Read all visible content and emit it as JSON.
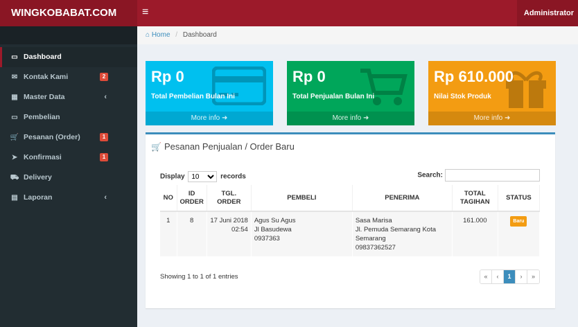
{
  "header": {
    "logo": "WINGKOBABAT.COM",
    "menu_icon": "≡",
    "user": "Administrator"
  },
  "sidebar": {
    "items": [
      {
        "label": "Dashboard",
        "icon": "monitor-icon",
        "glyph": "▭",
        "active": true
      },
      {
        "label": "Kontak Kami",
        "icon": "envelope-icon",
        "glyph": "✉",
        "badge": "2"
      },
      {
        "label": "Master Data",
        "icon": "grid-icon",
        "glyph": "▦",
        "chevron": "‹"
      },
      {
        "label": "Pembelian",
        "icon": "credit-card-icon",
        "glyph": "▭"
      },
      {
        "label": "Pesanan (Order)",
        "icon": "cart-icon",
        "glyph": "🛒",
        "badge": "1"
      },
      {
        "label": "Konfirmasi",
        "icon": "send-icon",
        "glyph": "➤",
        "badge": "1"
      },
      {
        "label": "Delivery",
        "icon": "truck-icon",
        "glyph": "⛟"
      },
      {
        "label": "Laporan",
        "icon": "book-icon",
        "glyph": "▤",
        "chevron": "‹"
      }
    ]
  },
  "breadcrumb": {
    "home": "Home",
    "current": "Dashboard",
    "separator": "/"
  },
  "stats": [
    {
      "value": "Rp 0",
      "label": "Total Pembelian Bulan Ini",
      "more": "More info",
      "color": "#00c0ef",
      "icon": "credit-card-icon"
    },
    {
      "value": "Rp 0",
      "label": "Total Penjualan Bulan Ini",
      "more": "More info",
      "color": "#00a65a",
      "icon": "cart-icon"
    },
    {
      "value": "Rp 610.000",
      "label": "Nilai Stok Produk",
      "more": "More info",
      "color": "#f39c12",
      "icon": "gift-icon"
    }
  ],
  "orders_panel": {
    "title": "Pesanan Penjualan / Order Baru",
    "display_label": "Display",
    "display_value": "10",
    "records_label": "records",
    "search_label": "Search:",
    "columns": [
      "NO",
      "ID ORDER",
      "TGL. ORDER",
      "PEMBELI",
      "PENERIMA",
      "TOTAL TAGIHAN",
      "STATUS"
    ],
    "rows": [
      {
        "no": "1",
        "id": "8",
        "date": "17 Juni 2018",
        "time": "02:54",
        "buyer_name": "Agus Su Agus",
        "buyer_address": "Jl Basudewa",
        "buyer_phone": "0937363",
        "recipient_name": "Sasa Marisa",
        "recipient_address": "Jl. Pemuda Semarang Kota Semarang",
        "recipient_phone": "09837362527",
        "total": "161.000",
        "status": "Baru"
      }
    ],
    "showing": "Showing 1 to 1 of 1 entries",
    "pagination": {
      "first": "«",
      "prev": "‹",
      "current": "1",
      "next": "›",
      "last": "»"
    }
  },
  "colors": {
    "topbar": "#9c1a2a",
    "sidebar": "#222d32",
    "accent": "#3c8dbc",
    "badge": "#dd4b39",
    "status_new": "#f39c12"
  }
}
